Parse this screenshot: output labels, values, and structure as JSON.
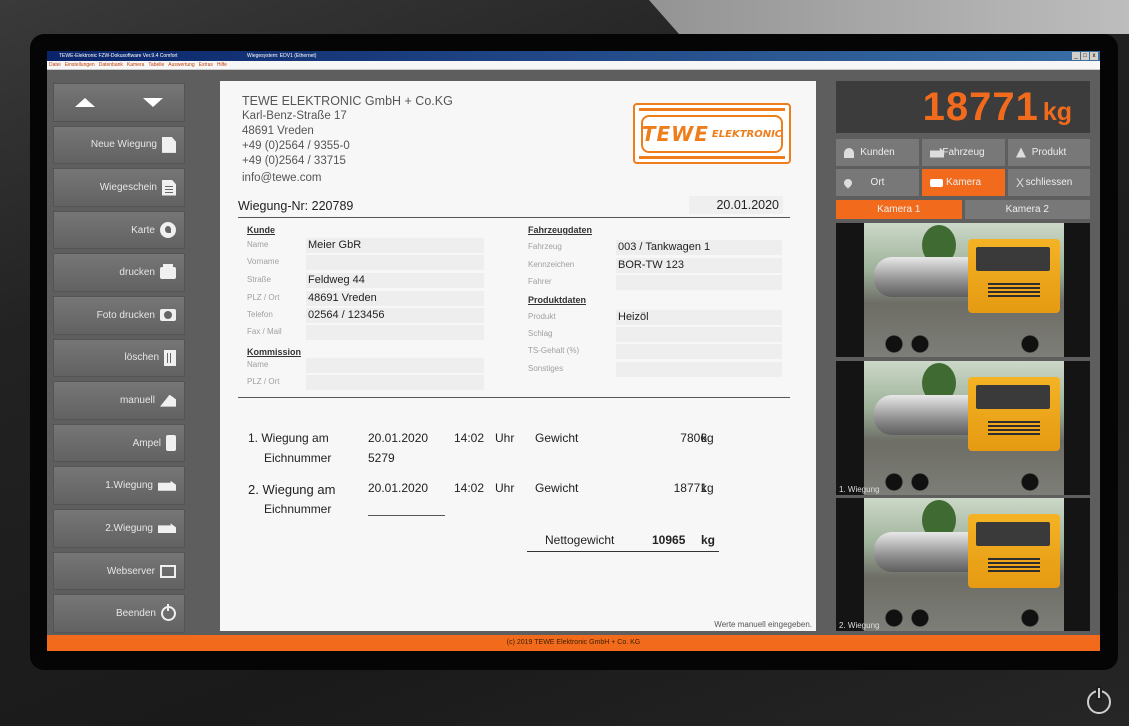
{
  "window": {
    "title": "TEWE-Elektronic FZW-Dokusoftware Ver.9.4 Comfort",
    "subtitle": "Wiegesystem: EDV1 (Ethernet)",
    "controls": [
      "_",
      "□",
      "x"
    ]
  },
  "menu": [
    "Datei",
    "Einstellungen",
    "Datenbank",
    "Kamera",
    "Tabelle",
    "Auswertung",
    "Extras",
    "Hilfe"
  ],
  "sidebar": {
    "buttons": [
      {
        "label": "Neue Wiegung",
        "icon": "document-icon"
      },
      {
        "label": "Wiegeschein",
        "icon": "document-lines-icon"
      },
      {
        "label": "Karte",
        "icon": "map-icon"
      },
      {
        "label": "drucken",
        "icon": "printer-icon"
      },
      {
        "label": "Foto drucken",
        "icon": "camera-icon"
      },
      {
        "label": "löschen",
        "icon": "trash-icon"
      },
      {
        "label": "manuell",
        "icon": "pen-icon"
      },
      {
        "label": "Ampel",
        "icon": "traffic-light-icon"
      },
      {
        "label": "1.Wiegung",
        "icon": "truck-icon"
      },
      {
        "label": "2.Wiegung",
        "icon": "truck-icon"
      },
      {
        "label": "Webserver",
        "icon": "monitor-icon"
      },
      {
        "label": "Beenden",
        "icon": "power-icon"
      }
    ]
  },
  "company": {
    "name": "TEWE ELEKTRONIC GmbH + Co.KG",
    "street": "Karl-Benz-Straße 17",
    "city": "48691 Vreden",
    "phone": "+49 (0)2564 / 9355-0",
    "fax": "+49 (0)2564 / 33715",
    "email": "info@tewe.com"
  },
  "logo": {
    "main": "TEWE",
    "sub": "ELEKTRONIC"
  },
  "wiegung": {
    "label": "Wiegung-Nr:",
    "number": "220789",
    "date": "20.01.2020"
  },
  "kunde": {
    "title": "Kunde",
    "fields": [
      {
        "label": "Name",
        "value": "Meier GbR"
      },
      {
        "label": "Vorname",
        "value": ""
      },
      {
        "label": "Straße",
        "value": "Feldweg 44"
      },
      {
        "label": "PLZ / Ort",
        "value": "48691 Vreden"
      },
      {
        "label": "Telefon",
        "value": "02564 / 123456"
      },
      {
        "label": "Fax / Mail",
        "value": ""
      }
    ]
  },
  "kommission": {
    "title": "Kommission",
    "fields": [
      {
        "label": "Name",
        "value": ""
      },
      {
        "label": "PLZ / Ort",
        "value": ""
      }
    ]
  },
  "fahrzeugdaten": {
    "title": "Fahrzeugdaten",
    "fields": [
      {
        "label": "Fahrzeug",
        "value": "003 / Tankwagen 1"
      },
      {
        "label": "Kennzeichen",
        "value": "BOR-TW 123"
      },
      {
        "label": "Fahrer",
        "value": ""
      }
    ]
  },
  "produktdaten": {
    "title": "Produktdaten",
    "fields": [
      {
        "label": "Produkt",
        "value": "Heizöl"
      },
      {
        "label": "Schlag",
        "value": ""
      },
      {
        "label": "TS-Gehalt (%)",
        "value": ""
      },
      {
        "label": "Sonstiges",
        "value": ""
      }
    ]
  },
  "weighings": {
    "first": {
      "label": "1. Wiegung am",
      "date": "20.01.2020",
      "time": "14:02",
      "time_unit": "Uhr",
      "weight_label": "Gewicht",
      "weight": "7806",
      "unit": "kg",
      "eich_label": "Eichnummer",
      "eich_value": "5279"
    },
    "second": {
      "label": "2. Wiegung am",
      "date": "20.01.2020",
      "time": "14:02",
      "time_unit": "Uhr",
      "weight_label": "Gewicht",
      "weight": "18771",
      "unit": "kg",
      "eich_label": "Eichnummer",
      "eich_value": ""
    },
    "netto": {
      "label": "Nettogewicht",
      "value": "10965",
      "unit": "kg"
    }
  },
  "note": "Werte manuell eingegeben.",
  "display": {
    "value": "18771",
    "unit": "kg"
  },
  "right_buttons": [
    {
      "label": "Kunden",
      "icon": "person-icon",
      "active": false
    },
    {
      "label": "Fahrzeug",
      "icon": "truck-icon",
      "active": false
    },
    {
      "label": "Produkt",
      "icon": "tree-icon",
      "active": false
    },
    {
      "label": "Ort",
      "icon": "location-pin-icon",
      "active": false
    },
    {
      "label": "Kamera",
      "icon": "camera-icon",
      "active": true
    },
    {
      "label": "schliessen",
      "icon": "close-icon",
      "active": false
    }
  ],
  "camera_tabs": [
    {
      "label": "Kamera 1",
      "active": true
    },
    {
      "label": "Kamera 2",
      "active": false
    }
  ],
  "camera_views": [
    {
      "caption": ""
    },
    {
      "caption": "1. Wiegung"
    },
    {
      "caption": "2. Wiegung"
    }
  ],
  "footer": "(c) 2019 TEWE Elektronic GmbH + Co. KG",
  "colors": {
    "accent": "#f26b1d",
    "panel": "#5e5e5e",
    "button": "#787878"
  }
}
